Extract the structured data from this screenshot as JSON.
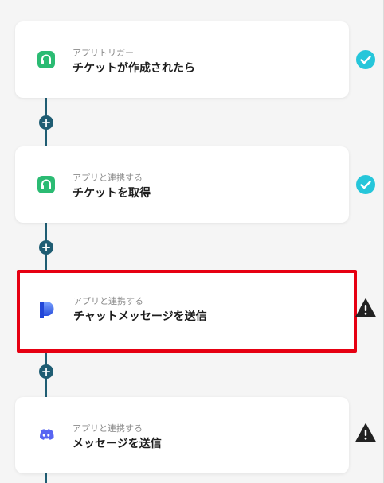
{
  "colors": {
    "connector": "#1f5d73",
    "check": "#26c6da",
    "warning": "#222222",
    "selection": "#e60012",
    "app_green": "#2bbb73",
    "discord": "#5865f2"
  },
  "flow": {
    "add_step_icon": "plus-icon",
    "steps": [
      {
        "kind": "アプリトリガー",
        "title": "チケットが作成されたら",
        "icon": "headset-app-icon",
        "status": "check-icon"
      },
      {
        "kind": "アプリと連携する",
        "title": "チケットを取得",
        "icon": "headset-app-icon",
        "status": "check-icon"
      },
      {
        "kind": "アプリと連携する",
        "title": "チャットメッセージを送信",
        "icon": "p-app-icon",
        "status": "warning-icon"
      },
      {
        "kind": "アプリと連携する",
        "title": "メッセージを送信",
        "icon": "discord-icon",
        "status": "warning-icon"
      }
    ]
  }
}
